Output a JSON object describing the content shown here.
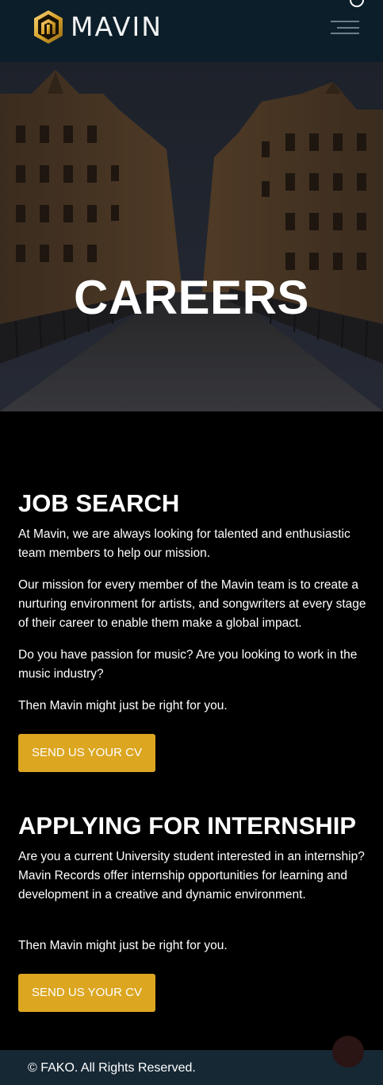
{
  "header": {
    "brand": "MAVIN"
  },
  "hero": {
    "title": "CAREERS"
  },
  "job_search": {
    "title": "JOB SEARCH",
    "paragraphs": [
      "At Mavin, we are always looking for talented and enthusiastic team members to help our mission.",
      "Our mission for every member of the Mavin team is to create a nurturing environment for artists, and songwriters at every stage of their career to enable them make a global impact.",
      "Do you have passion for music? Are you looking to work in the music industry?",
      "Then Mavin might just be right for you."
    ],
    "button_label": "SEND US YOUR CV"
  },
  "internship": {
    "title": "APPLYING FOR INTERNSHIP",
    "paragraphs": [
      "Are you a current University student interested in an internship? Mavin Records offer internship opportunities for learning and development in a creative and dynamic environment.",
      "Then Mavin might just be right for you."
    ],
    "button_label": "SEND US YOUR CV"
  },
  "footer": {
    "copyright": "© FAKO. All Rights Reserved."
  },
  "colors": {
    "header_bg": "#0b1e2a",
    "accent_gold": "#dca621",
    "footer_bg": "#162834",
    "page_bg": "#000000"
  },
  "icons": {
    "logo": "mavin-m-logo-icon",
    "menu": "hamburger-menu-icon",
    "ring": "circle-outline-icon",
    "scroll_top": "scroll-to-top-icon"
  }
}
